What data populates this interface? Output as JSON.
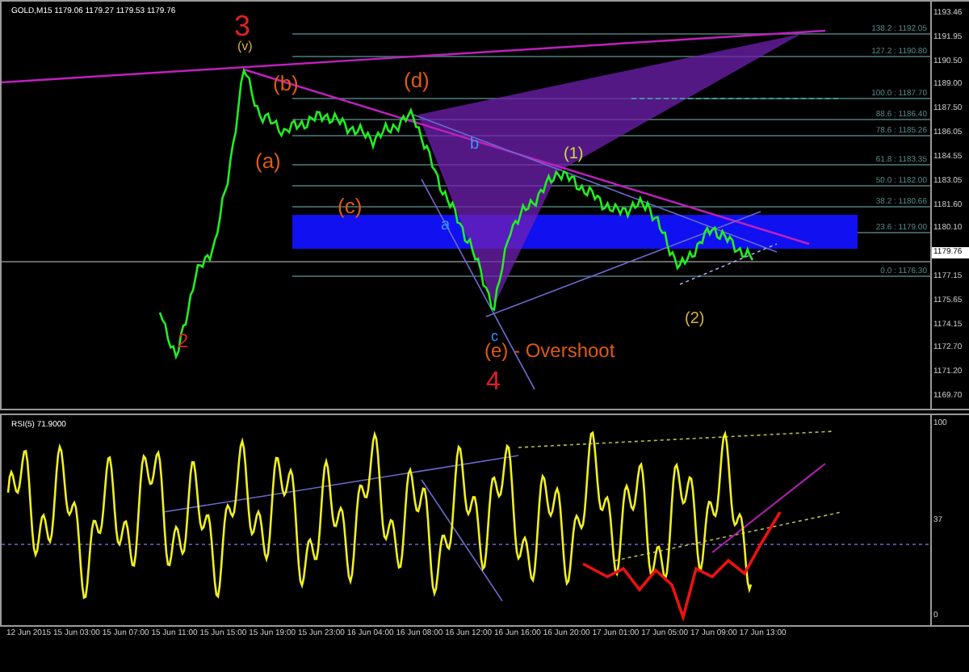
{
  "chart_header": "GOLD,M15  1179.06 1179.27 1179.53 1179.76",
  "price_axis": [
    {
      "label": "1193.46",
      "current": false
    },
    {
      "label": "1191.95",
      "current": false
    },
    {
      "label": "1190.50",
      "current": false
    },
    {
      "label": "1189.00",
      "current": false
    },
    {
      "label": "1187.50",
      "current": false
    },
    {
      "label": "1186.05",
      "current": false
    },
    {
      "label": "1184.55",
      "current": false
    },
    {
      "label": "1183.05",
      "current": false
    },
    {
      "label": "1181.60",
      "current": false
    },
    {
      "label": "1180.10",
      "current": false
    },
    {
      "label": "1179.76",
      "current": true
    },
    {
      "label": "1177.15",
      "current": false
    },
    {
      "label": "1175.65",
      "current": false
    },
    {
      "label": "1174.15",
      "current": false
    },
    {
      "label": "1172.70",
      "current": false
    },
    {
      "label": "1171.20",
      "current": false
    },
    {
      "label": "1169.70",
      "current": false
    }
  ],
  "fib_levels": [
    "138.2 : 1192.05",
    "127.2 : 1190.80",
    "100.0 : 1187.70",
    "88.6 : 1186.40",
    "78.6 : 1185.26",
    "61.8 : 1183.35",
    "50.0 : 1182.00",
    "38.2 : 1180.66",
    "23.6 : 1179.00",
    "0.0 : 1176.30"
  ],
  "wave_labels": [
    {
      "text": "3",
      "color": "#e02020"
    },
    {
      "text": "(v)",
      "color": "#d8b040"
    },
    {
      "text": "(b)",
      "color": "#e05a10"
    },
    {
      "text": "(d)",
      "color": "#e05a10"
    },
    {
      "text": "(a)",
      "color": "#e05a10"
    },
    {
      "text": "(c)",
      "color": "#e05a10"
    },
    {
      "text": "b",
      "color": "#3399ff"
    },
    {
      "text": "a",
      "color": "#3399ff"
    },
    {
      "text": "(1)",
      "color": "#c8e040"
    },
    {
      "text": "c",
      "color": "#3399ff"
    },
    {
      "text": "(e) - Overshoot",
      "color": "#e05a10"
    },
    {
      "text": "4",
      "color": "#e02020"
    },
    {
      "text": "(2)",
      "color": "#d8b040"
    },
    {
      "text": "2",
      "color": "#e02020"
    }
  ],
  "rsi": {
    "title": "RSI(5) 71.9000",
    "axis": [
      "100",
      "37",
      "0"
    ]
  },
  "time_axis": [
    "12 Jun 2015",
    "15 Jun 03:00",
    "15 Jun 07:00",
    "15 Jun 11:00",
    "15 Jun 15:00",
    "15 Jun 19:00",
    "15 Jun 23:00",
    "16 Jun 04:00",
    "16 Jun 08:00",
    "16 Jun 12:00",
    "16 Jun 16:00",
    "16 Jun 20:00",
    "17 Jun 01:00",
    "17 Jun 05:00",
    "17 Jun 09:00",
    "17 Jun 13:00"
  ]
}
